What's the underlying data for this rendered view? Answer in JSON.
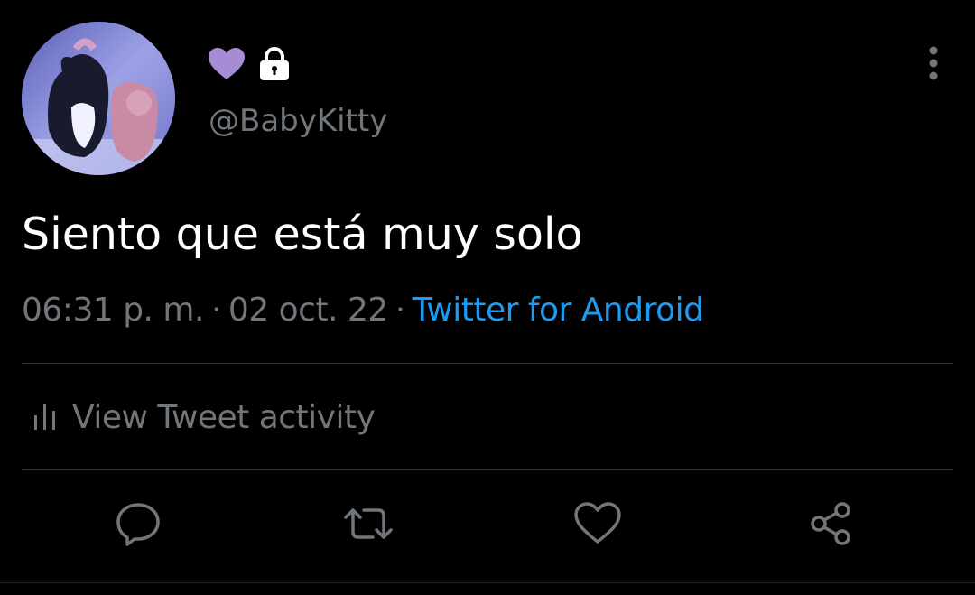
{
  "tweet": {
    "handle": "@BabyKitty",
    "text": "Siento que está muy solo",
    "time": "06:31 p. m.",
    "date": "02 oct. 22",
    "separator": "·",
    "source": "Twitter for Android"
  },
  "activity": {
    "label": "View Tweet activity"
  },
  "icons": {
    "name_badge_1": "purple-heart-icon",
    "name_badge_2": "lock-icon",
    "more": "more-vertical-icon",
    "activity": "bar-chart-icon",
    "reply": "reply-icon",
    "retweet": "retweet-icon",
    "like": "like-icon",
    "share": "share-icon"
  },
  "colors": {
    "background": "#000000",
    "primary_text": "#ffffff",
    "secondary_text": "#71767b",
    "link": "#1d9bf0",
    "divider": "#2f3336",
    "heart": "#a68bd6"
  }
}
